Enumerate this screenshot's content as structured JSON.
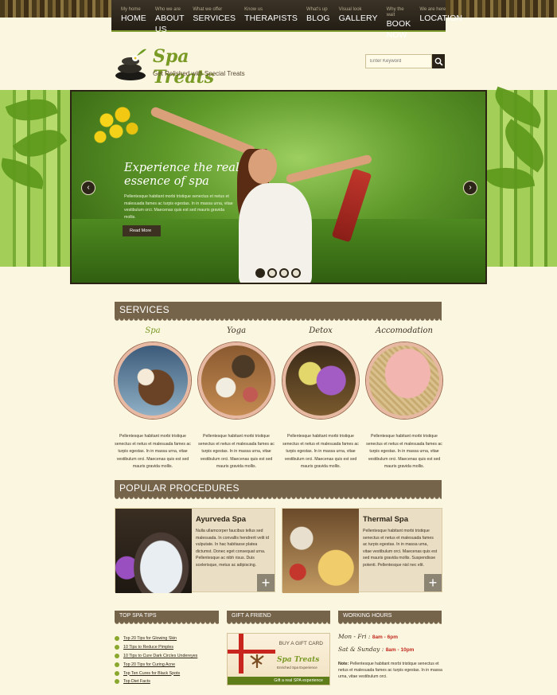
{
  "nav": [
    {
      "sub": "My home",
      "main": "HOME"
    },
    {
      "sub": "Who we are",
      "main": "ABOUT US"
    },
    {
      "sub": "What we offer",
      "main": "SERVICES"
    },
    {
      "sub": "Know us",
      "main": "THERAPISTS"
    },
    {
      "sub": "What's up",
      "main": "BLOG"
    },
    {
      "sub": "Visual look",
      "main": "GALLERY"
    },
    {
      "sub": "Why the wait",
      "main": "BOOK NOW"
    },
    {
      "sub": "We are here",
      "main": "LOCATION"
    }
  ],
  "logo": {
    "title": "Spa Treats",
    "tagline": "Get Relished with Special Treats"
  },
  "search": {
    "placeholder": "Enter Keyword"
  },
  "hero": {
    "title": "Experience the real essence of spa",
    "text": "Pellentesque habitant morbi tristique senectus et netus et malesuada fames ac turpis egestas. In in massa urna, vitae vestibulum orci. Maecenas quis est sed mauris gravida mollis.",
    "button": "Read More",
    "prev": "‹",
    "next": "›",
    "slides": 4,
    "active_slide": 1
  },
  "services": {
    "heading": "SERVICES",
    "items": [
      {
        "title": "Spa",
        "text": "Pellentesque habitant morbi tristique senectus et netus et malesuada fames ac turpis egestas. In in massa urna, vitae vestibulum orci. Maecenas quis est sed mauris gravida mollis."
      },
      {
        "title": "Yoga",
        "text": "Pellentesque habitant morbi tristique senectus et netus et malesuada fames ac turpis egestas. In in massa urna, vitae vestibulum orci. Maecenas quis est sed mauris gravida mollis."
      },
      {
        "title": "Detox",
        "text": "Pellentesque habitant morbi tristique senectus et netus et malesuada fames ac turpis egestas. In in massa urna, vitae vestibulum orci. Maecenas quis est sed mauris gravida mollis."
      },
      {
        "title": "Accomodation",
        "text": "Pellentesque habitant morbi tristique senectus et netus et malesuada fames ac turpis egestas. In in massa urna, vitae vestibulum orci. Maecenas quis est sed mauris gravida mollis."
      }
    ]
  },
  "procedures": {
    "heading": "POPULAR PROCEDURES",
    "items": [
      {
        "title": "Ayurveda Spa",
        "text": "Nulla ullamcorper faucibus tellus sed malesuada. In convallis hendrerit velit id vulputate. In hac habitasse platea dictumst. Donec eget consequat urna. Pellentesque ac nibh risus. Duis scelerisque, metus ac adipiscing."
      },
      {
        "title": "Thermal Spa",
        "text": "Pellentesque habitant morbi tristique senectus et netus et malesuada fames ac turpis egestas. In in massa urna, vitae vestibulum orci. Maecenas quis est sed mauris gravida mollis. Suspendisse potenti. Pellentesque nisl nec elit."
      }
    ],
    "plus": "+"
  },
  "tips": {
    "heading": "TOP SPA TIPS",
    "items": [
      "Top 20 Tips for Glowing Skin",
      "10 Tips to Reduce Pimples",
      "10 Tips to Cure Dark Circles Undereyes",
      "Top 20 Tips for Curing Acne",
      "Top Ten Cures for Black Spots",
      "Top Diet Facts"
    ]
  },
  "gift": {
    "heading": "GIFT A FRIEND",
    "card_label": "BUY A GIFT CARD",
    "card_logo": "Spa Treats",
    "card_sub": "Enriched Spa Experience",
    "card_footer": "Gift a real SPA experience"
  },
  "hours": {
    "heading": "WORKING HOURS",
    "weekday_label": "Mon - Fri :",
    "weekday_time": "8am - 6pm",
    "weekend_label": "Sat & Sunday :",
    "weekend_time": "8am - 10pm",
    "note_label": "Note:",
    "note": "Pellentesque habitant morbi tristique senectus et netus et malesuada fames ac turpis egestas. In in massa urna, vitae vestibulum orci."
  }
}
